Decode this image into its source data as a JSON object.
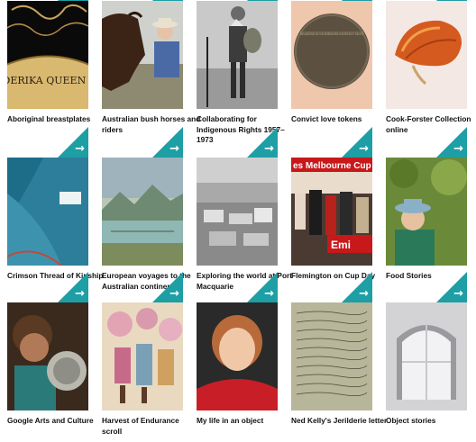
{
  "accent_color": "#1e9ea5",
  "arrow_icon": "arrow-right-icon",
  "tiles": [
    {
      "title": "Aboriginal breastplates",
      "image_text": "ADA DERIKA QUEEN OF D"
    },
    {
      "title": "Australian bush horses and riders"
    },
    {
      "title": "Collaborating for Indigenous Rights 1957–1973"
    },
    {
      "title": "Convict love tokens",
      "image_text": "DEAR ELIZABETH WHEN THIS YOU SEE REMEMBER ME WHEN I AM FAR FROM THEE IN 7 YEARS SEVEN"
    },
    {
      "title": "Cook-Forster Collection online"
    },
    {
      "title": "Crimson Thread of Kinship"
    },
    {
      "title": "European voyages to the Australian continent"
    },
    {
      "title": "Exploring the world at Port Macquarie"
    },
    {
      "title": "Flemington on Cup Day",
      "image_text": "es Melbourne Cup",
      "image_text_2": "Emi"
    },
    {
      "title": "Food Stories"
    },
    {
      "title": "Google Arts and Culture"
    },
    {
      "title": "Harvest of Endurance scroll"
    },
    {
      "title": "My life in an object"
    },
    {
      "title": "Ned Kelly's Jerilderie letter"
    },
    {
      "title": "Object stories"
    }
  ]
}
